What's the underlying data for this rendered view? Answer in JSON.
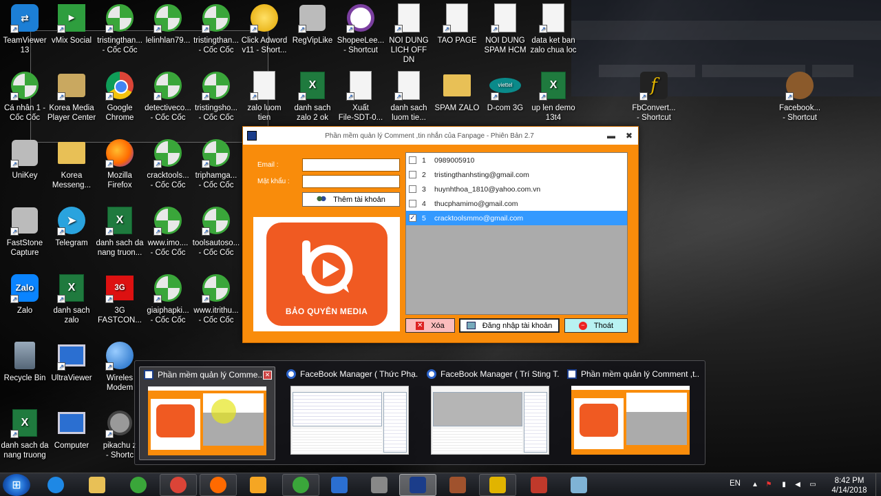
{
  "desktop_icons": [
    {
      "label": "TeamViewer\n13",
      "icon": "teamviewer-icon"
    },
    {
      "label": "vMix Social",
      "icon": "vmix-icon"
    },
    {
      "label": "tristingthan...\n- Cốc Cốc",
      "icon": "coccoc-icon"
    },
    {
      "label": "lelinhlan79...",
      "icon": "coccoc-icon"
    },
    {
      "label": "tristingthan...\n- Cốc Cốc",
      "icon": "coccoc-icon"
    },
    {
      "label": "Click Adword\nv11 - Short...",
      "icon": "clickadword-icon"
    },
    {
      "label": "RegVipLike",
      "icon": "regviplike-icon"
    },
    {
      "label": "ShopeeLee...\n- Shortcut",
      "icon": "shopee-icon"
    },
    {
      "label": "NOI DUNG\nLICH OFF DN",
      "icon": "document-icon"
    },
    {
      "label": "TAO PAGE",
      "icon": "document-icon"
    },
    {
      "label": "NOI DUNG\nSPAM HCM",
      "icon": "document-icon"
    },
    {
      "label": "data ket ban\nzalo chua loc",
      "icon": "document-icon"
    },
    {
      "label": "Cá nhân 1 -\nCốc Cốc",
      "icon": "coccoc-icon"
    },
    {
      "label": "Korea Media\nPlayer Center",
      "icon": "kmplayer-icon"
    },
    {
      "label": "Google\nChrome",
      "icon": "chrome-icon"
    },
    {
      "label": "detectiveco...\n- Cốc Cốc",
      "icon": "coccoc-icon"
    },
    {
      "label": "tristingsho...\n- Cốc Cốc",
      "icon": "coccoc-icon"
    },
    {
      "label": "zalo luom\ntien",
      "icon": "document-icon"
    },
    {
      "label": "danh sach\nzalo 2 ok",
      "icon": "excel-icon"
    },
    {
      "label": "Xuất\nFile-SDT-0...",
      "icon": "document-icon"
    },
    {
      "label": "danh sach\nluom tie...",
      "icon": "document-icon"
    },
    {
      "label": "SPAM ZALO",
      "icon": "folder-icon"
    },
    {
      "label": "D-com 3G",
      "icon": "viettel-icon"
    },
    {
      "label": "up len demo\n13t4",
      "icon": "excel-icon"
    },
    {
      "label": "FbConvert...\n- Shortcut",
      "icon": "fbconvert-icon"
    },
    {
      "label": "Facebook...\n- Shortcut",
      "icon": "facebook-tool-icon"
    },
    {
      "label": "UniKey",
      "icon": "unikey-icon"
    },
    {
      "label": "Korea\nMesseng...",
      "icon": "folder-icon"
    },
    {
      "label": "Mozilla\nFirefox",
      "icon": "firefox-icon"
    },
    {
      "label": "cracktools...\n- Cốc Cốc",
      "icon": "coccoc-icon"
    },
    {
      "label": "triphamga...\n- Cốc Cốc",
      "icon": "coccoc-icon"
    },
    {
      "label": "FastStone\nCapture",
      "icon": "faststone-icon"
    },
    {
      "label": "Telegram",
      "icon": "telegram-icon"
    },
    {
      "label": "danh sach da\nnang truon...",
      "icon": "excel-icon"
    },
    {
      "label": "www.imo....\n- Cốc Cốc",
      "icon": "coccoc-icon"
    },
    {
      "label": "toolsautoso...\n- Cốc Cốc",
      "icon": "coccoc-icon"
    },
    {
      "label": "Zalo",
      "icon": "zalo-icon"
    },
    {
      "label": "danh sach\nzalo",
      "icon": "excel-icon"
    },
    {
      "label": "3G\nFASTCON...",
      "icon": "3g-icon"
    },
    {
      "label": "giaiphapki...\n- Cốc Cốc",
      "icon": "coccoc-icon"
    },
    {
      "label": "www.itrithu...\n- Cốc Cốc",
      "icon": "coccoc-icon"
    },
    {
      "label": "Recycle Bin",
      "icon": "recycle-bin-icon"
    },
    {
      "label": "UltraViewer",
      "icon": "ultraviewer-icon"
    },
    {
      "label": "Wireles\nModem",
      "icon": "globe-icon"
    },
    {
      "label": "danh sach da\nnang truong",
      "icon": "excel-icon"
    },
    {
      "label": "Computer",
      "icon": "computer-icon"
    },
    {
      "label": "pikachu z\n- Shortc",
      "icon": "webcam-icon"
    }
  ],
  "app": {
    "title": "Phần mềm quản lý Comment ,tin nhắn của Fanpage - Phiên Bản 2.7",
    "email_label": "Email :",
    "email_value": "",
    "password_label": "Mật khẩu :",
    "password_value": "",
    "add_account_label": "Thêm tài khoản",
    "logo_text": "BẢO QUYÊN MEDIA",
    "accounts": [
      {
        "num": "1",
        "value": "0989005910",
        "checked": false
      },
      {
        "num": "2",
        "value": "tristingthanhsting@gmail.com",
        "checked": false
      },
      {
        "num": "3",
        "value": "huynhthoa_1810@yahoo.com.vn",
        "checked": false
      },
      {
        "num": "4",
        "value": "thucphamimo@gmail.com",
        "checked": false
      },
      {
        "num": "5",
        "value": "cracktoolsmmo@gmail.com",
        "checked": true
      }
    ],
    "delete_label": "Xóa",
    "login_label": "Đăng nhập tài khoản",
    "exit_label": "Thoát",
    "minimize_glyph": "▬",
    "close_glyph": "✖"
  },
  "thumbnails": [
    {
      "title": "Phần mềm quản lý Comme...",
      "type": "app"
    },
    {
      "title": "FaceBook Manager ( Thức Phạ...",
      "type": "manager"
    },
    {
      "title": "FaceBook Manager ( Trí Sting T...",
      "type": "manager"
    },
    {
      "title": "Phần mềm quản lý Comment ,t...",
      "type": "app"
    }
  ],
  "taskbar": {
    "language": "EN",
    "time": "8:42 PM",
    "date": "4/14/2018",
    "items": [
      "internet-explorer-icon",
      "file-explorer-icon",
      "coccoc-icon",
      "chrome-icon",
      "firefox-icon",
      "media-player-icon",
      "coccoc-icon",
      "ultraviewer-icon",
      "ninja-icon",
      "comment-manager-icon",
      "bear-icon",
      "fbconvert-icon",
      "house-icon",
      "notepad-icon"
    ]
  }
}
